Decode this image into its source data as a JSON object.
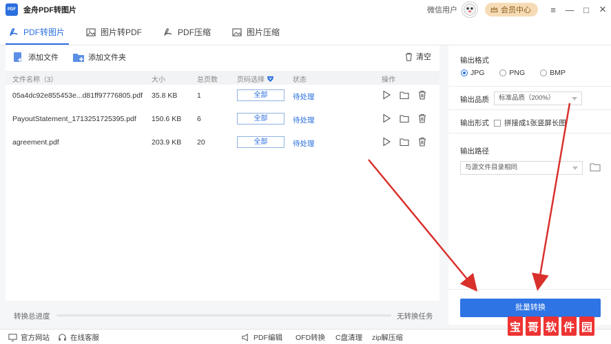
{
  "app": {
    "logo_text": "PDF",
    "title": "金舟PDF转图片"
  },
  "account": {
    "username": "微信用户",
    "member_label": "会员中心"
  },
  "window_controls": {
    "menu": "≡",
    "minimize": "—",
    "maximize": "□",
    "close": "✕"
  },
  "tabs": [
    {
      "label": "PDF转图片",
      "active": true,
      "icon": "pdf-to-image-icon"
    },
    {
      "label": "图片转PDF",
      "active": false,
      "icon": "image-to-pdf-icon"
    },
    {
      "label": "PDF压缩",
      "active": false,
      "icon": "pdf-compress-icon"
    },
    {
      "label": "图片压缩",
      "active": false,
      "icon": "image-compress-icon"
    }
  ],
  "toolbar": {
    "add_file": "添加文件",
    "add_folder": "添加文件夹",
    "clear": "清空"
  },
  "table": {
    "headers": {
      "name": "文件名称（3）",
      "size": "大小",
      "pages": "总页数",
      "range": "页码选择",
      "status": "状态",
      "ops": "操作"
    },
    "rows": [
      {
        "name": "05a4dc92e855453e...d81ff97776805.pdf",
        "size": "35.8 KB",
        "pages": "1",
        "range": "全部",
        "status": "待处理"
      },
      {
        "name": "PayoutStatement_1713251725395.pdf",
        "size": "150.6 KB",
        "pages": "6",
        "range": "全部",
        "status": "待处理"
      },
      {
        "name": "agreement.pdf",
        "size": "203.9 KB",
        "pages": "20",
        "range": "全部",
        "status": "待处理"
      }
    ]
  },
  "progress": {
    "label": "转换总进度",
    "status": "无转换任务",
    "fraction": 0
  },
  "settings": {
    "format_label": "输出格式",
    "formats": [
      {
        "label": "JPG",
        "checked": true
      },
      {
        "label": "PNG",
        "checked": false
      },
      {
        "label": "BMP",
        "checked": false
      }
    ],
    "quality_label": "输出品质",
    "quality_value": "标准品质（200%）",
    "form_label": "输出形式",
    "form_checkbox": "拼接成1张竖屏长图",
    "path_label": "输出路径",
    "path_value": "与源文件目录相同",
    "batch_button": "批量转换"
  },
  "footer": {
    "website": "官方网站",
    "support": "在线客服",
    "pdf_edit": "PDF编辑",
    "ofd": "OFD转换",
    "cdisk": "C盘清理",
    "zip": "zip解压缩"
  },
  "watermark": {
    "chars": [
      "宝",
      "哥",
      "软",
      "件",
      "园"
    ]
  },
  "colors": {
    "accent": "#2b6fde",
    "button": "#2f74e5",
    "arrow": "#d9302c",
    "member_bg": "#f6dcb6"
  }
}
